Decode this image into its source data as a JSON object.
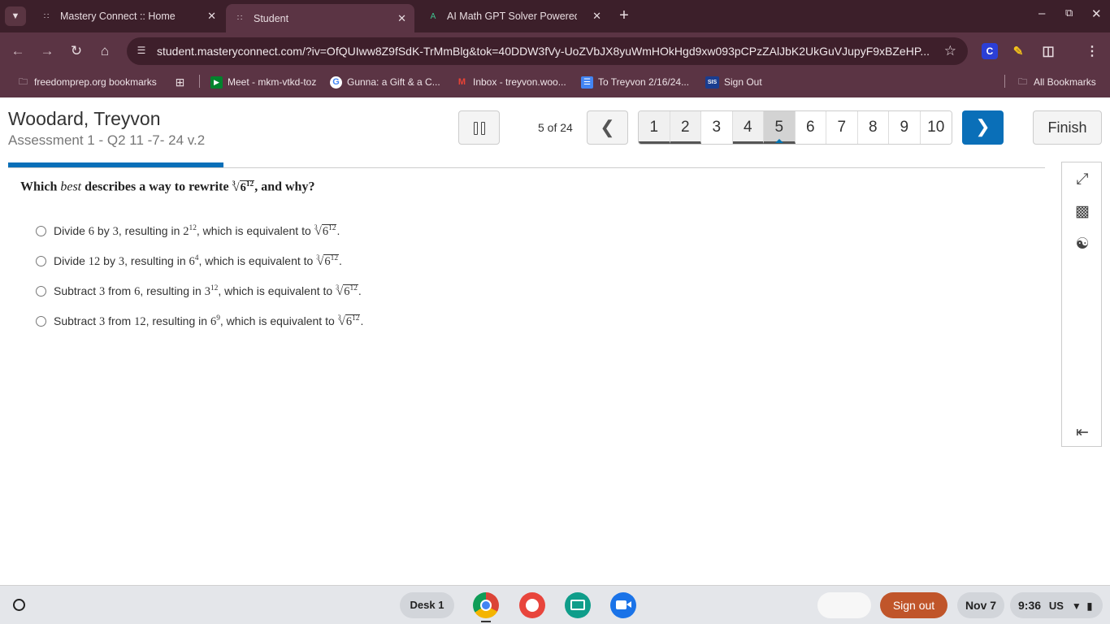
{
  "browser": {
    "tabs": [
      {
        "label": "Mastery Connect :: Home",
        "active": false
      },
      {
        "label": "Student",
        "active": true
      },
      {
        "label": "AI Math GPT Solver Powered by",
        "active": false
      }
    ],
    "url": "student.masteryconnect.com/?iv=OfQUIww8Z9fSdK-TrMmBlg&tok=40DDW3fVy-UoZVbJX8yuWmHOkHgd9xw093pCPzZAlJbK2UkGuVJupyF9xBZeHP...",
    "bookmarks": [
      {
        "label": "freedomprep.org bookmarks",
        "icon": "folder-icon"
      },
      {
        "label": "Meet - mkm-vtkd-toz",
        "icon": "meet-icon"
      },
      {
        "label": "Gunna: a Gift & a C...",
        "icon": "google-icon"
      },
      {
        "label": "Inbox - treyvon.woo...",
        "icon": "gmail-icon"
      },
      {
        "label": "To Treyvon 2/16/24...",
        "icon": "docs-icon"
      },
      {
        "label": "Sign Out",
        "icon": "sis-icon"
      }
    ],
    "all_bookmarks": "All Bookmarks",
    "ext_c": "C",
    "sis": "SIS"
  },
  "assessment": {
    "student_name": "Woodard, Treyvon",
    "title": "Assessment 1 - Q2 11 -7- 24 v.2",
    "progress_text": "5 of 24",
    "progress_fraction": 0.208,
    "question_numbers": [
      "1",
      "2",
      "3",
      "4",
      "5",
      "6",
      "7",
      "8",
      "9",
      "10"
    ],
    "answered": [
      "1",
      "2",
      "4"
    ],
    "current": "5",
    "finish_label": "Finish"
  },
  "question": {
    "pre": "Which ",
    "emphasis": "best",
    "mid": " describes a way to rewrite ",
    "post": ", and why?"
  },
  "options": [
    {
      "p1": "Divide ",
      "n1": "6",
      "p2": " by ",
      "n2": "3",
      "p3": ", resulting in ",
      "base": "2",
      "exp": "12",
      "p4": ", which is equivalent to "
    },
    {
      "p1": "Divide ",
      "n1": "12",
      "p2": " by ",
      "n2": "3",
      "p3": ", resulting in ",
      "base": "6",
      "exp": "4",
      "p4": ", which is equivalent to "
    },
    {
      "p1": "Subtract ",
      "n1": "3",
      "p2": " from ",
      "n2": "6",
      "p3": ", resulting in ",
      "base": "3",
      "exp": "12",
      "p4": ", which is equivalent to "
    },
    {
      "p1": "Subtract ",
      "n1": "3",
      "p2": " from ",
      "n2": "12",
      "p3": ", resulting in ",
      "base": "6",
      "exp": "9",
      "p4": ", which is equivalent to "
    }
  ],
  "radical": {
    "index": "3",
    "base": "6",
    "exp": "12"
  },
  "shelf": {
    "desk": "Desk 1",
    "signout": "Sign out",
    "date": "Nov 7",
    "time": "9:36",
    "locale": "US"
  },
  "colors": {
    "accent": "#0a6fb8",
    "browser_frame": "#5b3444",
    "signout": "#c0552a"
  }
}
